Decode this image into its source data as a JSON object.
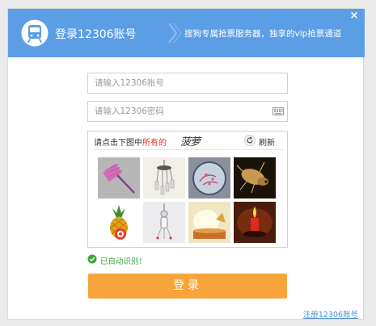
{
  "header": {
    "title": "登录12306账号",
    "slogan": "搜狗专属抢票服务器，独享的vip抢票通道",
    "close_glyph": "×",
    "accent_color": "#5b9ee6"
  },
  "form": {
    "username_placeholder": "请输入12306账号",
    "password_placeholder": "请输入12306密码"
  },
  "captcha": {
    "prompt": "请点击下图中",
    "prompt_highlight": "所有的",
    "target_word": "菠萝",
    "refresh_label": "刷新",
    "tiles": [
      {
        "name": "captcha-tile-fly-swatter",
        "subject": "fly-swatter"
      },
      {
        "name": "captcha-tile-wind-chime",
        "subject": "wind-chime"
      },
      {
        "name": "captcha-tile-embroidery",
        "subject": "embroidery"
      },
      {
        "name": "captcha-tile-insect",
        "subject": "insect"
      },
      {
        "name": "captcha-tile-pineapple",
        "subject": "pineapple"
      },
      {
        "name": "captcha-tile-ornament",
        "subject": "ornament"
      },
      {
        "name": "captcha-tile-candle-glow",
        "subject": "candle-glow"
      },
      {
        "name": "captcha-tile-candle",
        "subject": "candle"
      }
    ]
  },
  "status": {
    "auto_recognized": "已自动识别！",
    "ok_color": "#3da53d"
  },
  "actions": {
    "login_label": "登录",
    "register_link": "注册12306账号",
    "login_color": "#f7a53b"
  }
}
